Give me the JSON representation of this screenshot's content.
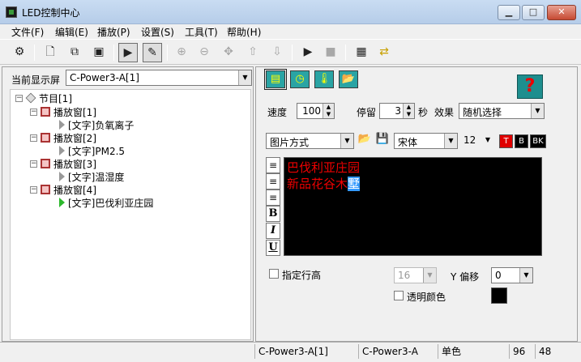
{
  "window": {
    "title": "LED控制中心",
    "min_icon": "minimize-icon",
    "max_icon": "maximize-icon",
    "close_icon": "close-icon"
  },
  "menu": [
    {
      "label": "文件(F)"
    },
    {
      "label": "编辑(E)"
    },
    {
      "label": "播放(P)"
    },
    {
      "label": "设置(S)"
    },
    {
      "label": "工具(T)"
    },
    {
      "label": "帮助(H)"
    }
  ],
  "toolbar": {
    "icons": [
      "settings-gear-icon",
      "new-file-icon",
      "copy-screen-icon",
      "window-icon",
      "program-icon",
      "edit-program-icon",
      "add-item-icon",
      "delete-item-icon",
      "move-icon",
      "up-arrow-icon",
      "down-arrow-icon",
      "play-icon",
      "stop-icon",
      "grid-icon",
      "send-icon"
    ]
  },
  "left": {
    "screen_label": "当前显示屏",
    "screen_value": "C-Power3-A[1]",
    "tree": {
      "root": "节目[1]",
      "windows": [
        {
          "label": "播放窗[1]",
          "child": "[文字]负氧离子"
        },
        {
          "label": "播放窗[2]",
          "child": "[文字]PM2.5"
        },
        {
          "label": "播放窗[3]",
          "child": "[文字]温湿度"
        },
        {
          "label": "播放窗[4]",
          "child": "[文字]巴伐利亚庄园"
        }
      ]
    }
  },
  "right": {
    "tabs": [
      "text-tab-icon",
      "clock-tab-icon",
      "thermometer-tab-icon",
      "open-folder-tab-icon"
    ],
    "help": "?",
    "speed_label": "速度",
    "speed_value": "100",
    "stay_label": "停留",
    "stay_value": "3",
    "stay_unit": "秒",
    "effect_label": "效果",
    "effect_value": "随机选择",
    "mode_value": "图片方式",
    "font_value": "宋体",
    "size_value": "12",
    "color_buttons": [
      "T",
      "B",
      "BK"
    ],
    "format_buttons": [
      "B",
      "I",
      "U"
    ],
    "editor_lines": [
      "巴伐利亚庄园",
      "新品花谷木"
    ],
    "editor_selected": "墅",
    "fixed_height_label": "指定行高",
    "line_height_value": "16",
    "y_offset_label": "Y 偏移",
    "y_offset_value": "0",
    "transparent_label": "透明颜色"
  },
  "status": {
    "cells": [
      "C-Power3-A[1]",
      "C-Power3-A",
      "单色",
      "96",
      "48"
    ]
  },
  "colors": {
    "accent": "#2aa4a4",
    "text_red": "#e00000",
    "editor_bg": "#000000"
  }
}
